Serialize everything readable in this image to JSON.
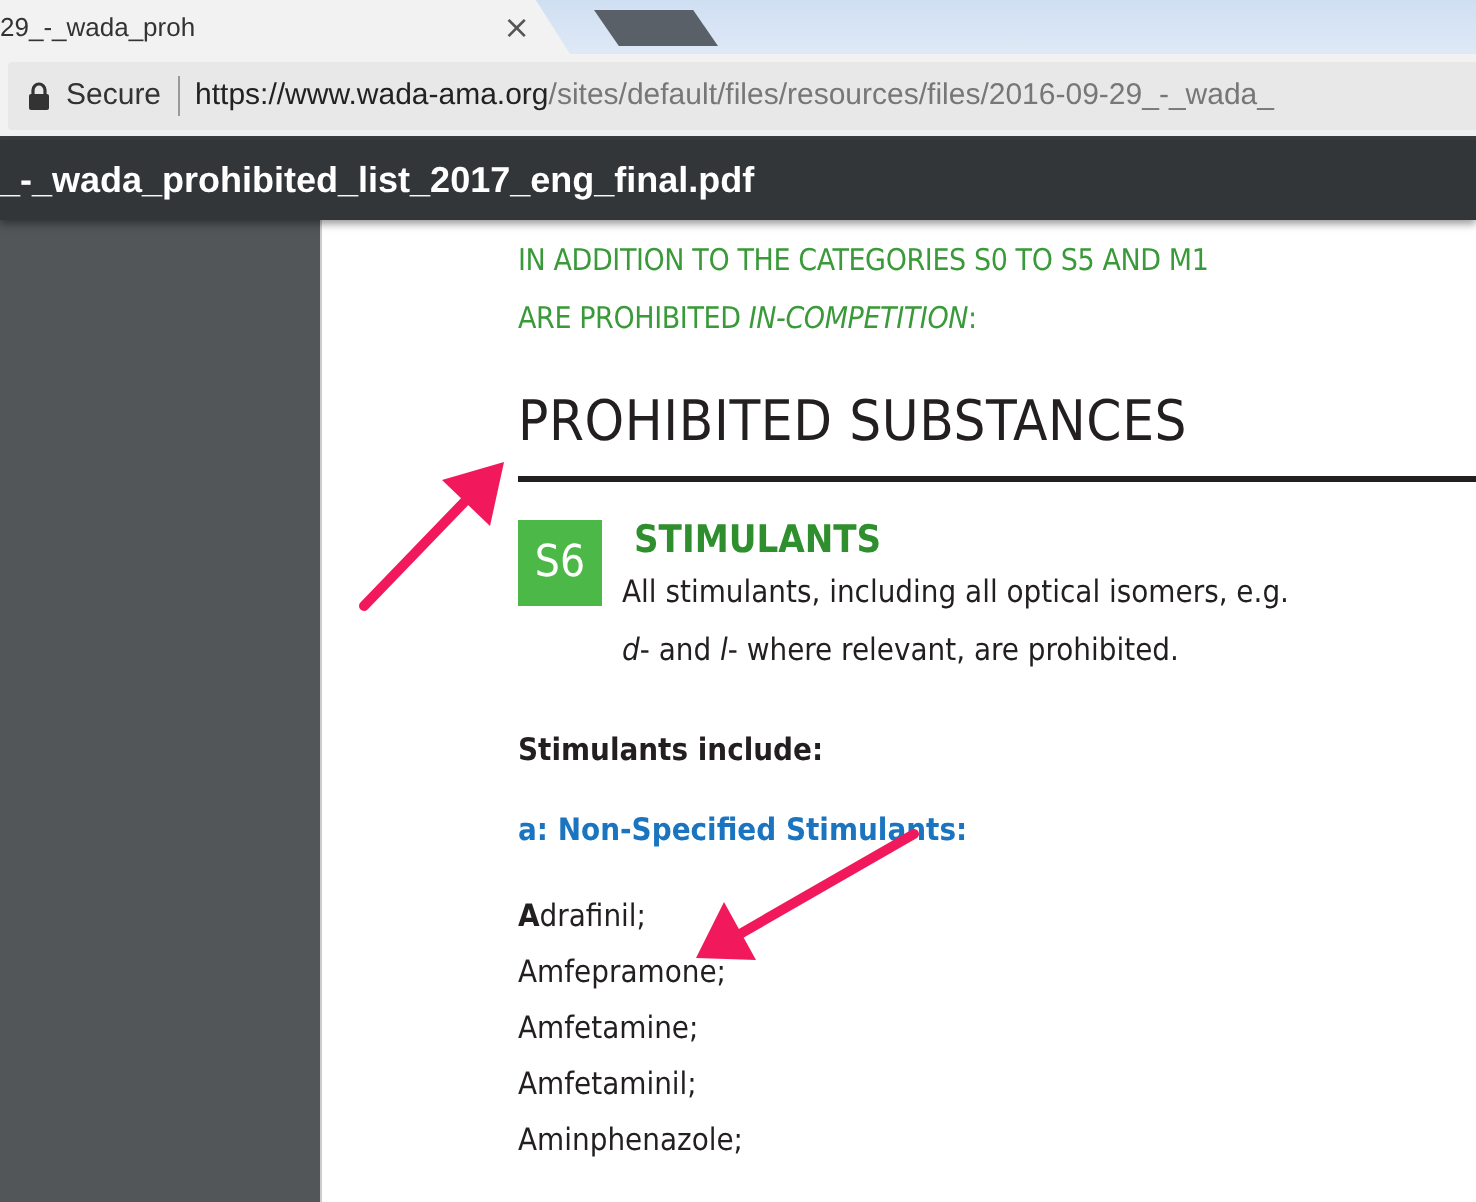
{
  "browser": {
    "tab": {
      "title": "29_-_wada_proh",
      "close": "×"
    },
    "address_bar": {
      "security_label": "Secure",
      "url_host": "https://www.wada-ama.org",
      "url_path": "/sites/default/files/resources/files/2016-09-29_-_wada_"
    },
    "pdf_title": "_-_wada_prohibited_list_2017_eng_final.pdf"
  },
  "document": {
    "intro_lines": [
      "IN ADDITION TO THE CATEGORIES S0 TO S5 AND M1",
      "ARE PROHIBITED *IN-COMPETITION*:"
    ],
    "heading": "PROHIBITED SUBSTANCES",
    "section": {
      "code": "S6",
      "title": "STIMULANTS",
      "description_lines": [
        "All stimulants, including all optical isomers, e.g.",
        "*d*- and *l*- where relevant, are prohibited."
      ]
    },
    "subheading": "Stimulants include:",
    "group_title": "a: Non-Specified Stimulants:",
    "substances": [
      "**A**drafinil;",
      "Amfepramone;",
      "Amfetamine;",
      "Amfetaminil;",
      "Aminphenazole;"
    ]
  }
}
